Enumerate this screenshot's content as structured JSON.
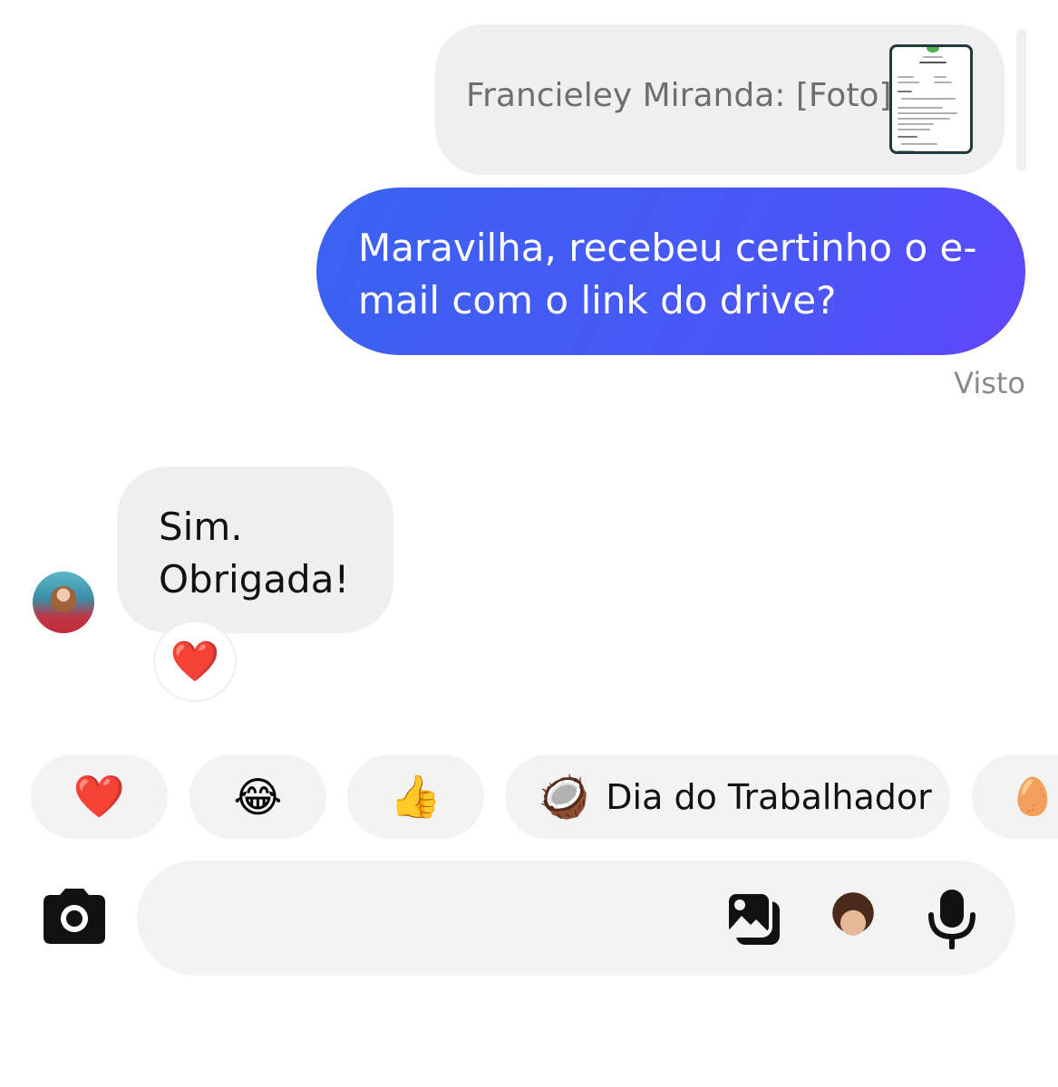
{
  "thread": {
    "reply_quote": {
      "text": "Francieley Miranda: [Foto]",
      "thumbnail_icon": "photo-thumbnail"
    },
    "outgoing_message": {
      "text": "Maravilha, recebeu certinho o e-mail com o link do drive?",
      "seen_label": "Visto",
      "bubble_gradient": [
        "#3a63f0",
        "#6046fb"
      ]
    },
    "incoming_message": {
      "text": "Sim. Obrigada!",
      "reaction": "❤️"
    }
  },
  "quick_reactions": [
    {
      "emoji": "❤️",
      "label": ""
    },
    {
      "emoji": "😂",
      "label": ""
    },
    {
      "emoji": "👍",
      "label": ""
    },
    {
      "emoji": "🥥",
      "label": "Dia do Trabalhador"
    },
    {
      "emoji": "🥚",
      "label": ""
    }
  ],
  "composer": {
    "camera_icon": "camera-icon",
    "gallery_icon": "gallery-icon",
    "sticker_icon": "avatar-sticker-icon",
    "mic_icon": "microphone-icon"
  },
  "colors": {
    "background": "#ffffff",
    "bubble_gray": "#efefef",
    "accent_blue": "#3a63f0"
  }
}
